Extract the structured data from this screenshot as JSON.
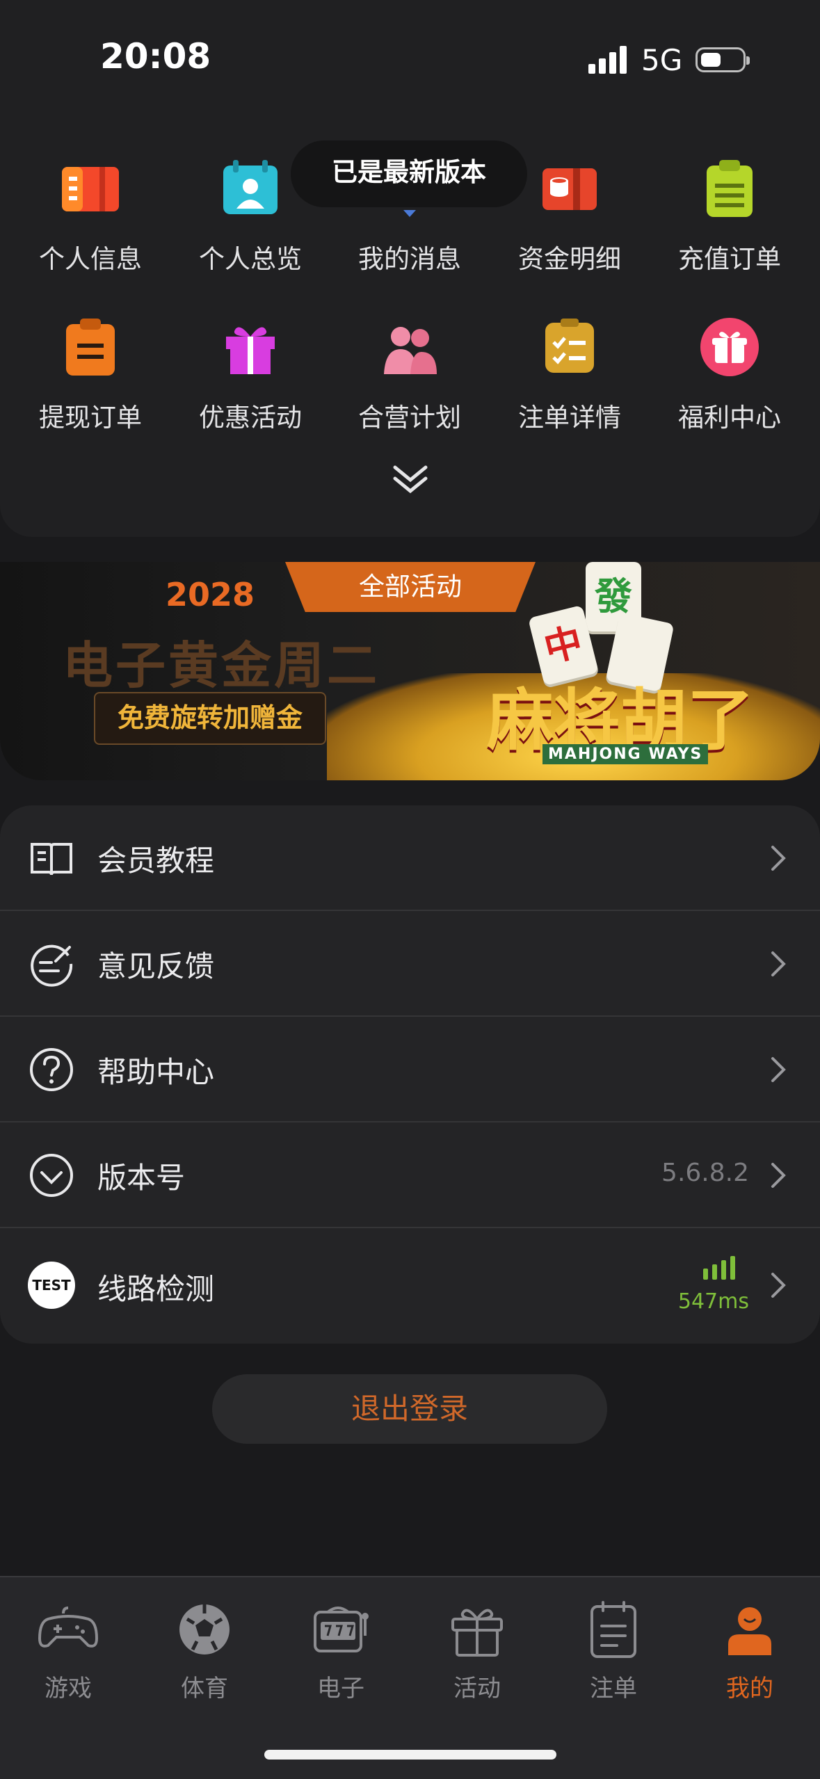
{
  "status": {
    "time": "20:08",
    "network": "5G"
  },
  "toast": "已是最新版本",
  "grid": [
    {
      "label": "个人信息",
      "icon": "profile-card-icon",
      "color": "#f4482a"
    },
    {
      "label": "个人总览",
      "icon": "calendar-user-icon",
      "color": "#2dbfd6"
    },
    {
      "label": "我的消息",
      "icon": "message-icon",
      "color": "#4a7ad8"
    },
    {
      "label": "资金明细",
      "icon": "funds-icon",
      "color": "#e6452b"
    },
    {
      "label": "充值订单",
      "icon": "clipboard-icon",
      "color": "#b5d62a"
    },
    {
      "label": "提现订单",
      "icon": "withdraw-icon",
      "color": "#f07a1e"
    },
    {
      "label": "优惠活动",
      "icon": "gift-icon",
      "color": "#d83de0"
    },
    {
      "label": "合营计划",
      "icon": "partners-icon",
      "color": "#f08da8"
    },
    {
      "label": "注单详情",
      "icon": "checklist-icon",
      "color": "#d9a42c"
    },
    {
      "label": "福利中心",
      "icon": "welfare-gift-icon",
      "color": "#f2456e"
    }
  ],
  "banner": {
    "tag": "全部活动",
    "year": "2028",
    "title": "电子黄金周二",
    "button": "免费旋转加赠金",
    "logo": "麻将胡了",
    "logo_sub": "MAHJONG WAYS"
  },
  "menu": {
    "tutorial": "会员教程",
    "feedback": "意见反馈",
    "help": "帮助中心",
    "version_label": "版本号",
    "version_value": "5.6.8.2",
    "line_test": "线路检测",
    "line_test_badge": "TEST",
    "latency": "547ms"
  },
  "logout": "退出登录",
  "tabs": [
    {
      "label": "游戏",
      "icon": "gamepad-icon",
      "active": false
    },
    {
      "label": "体育",
      "icon": "soccer-ball-icon",
      "active": false
    },
    {
      "label": "电子",
      "icon": "slot-machine-icon",
      "active": false
    },
    {
      "label": "活动",
      "icon": "gift-box-icon",
      "active": false
    },
    {
      "label": "注单",
      "icon": "clipboard-list-icon",
      "active": false
    },
    {
      "label": "我的",
      "icon": "user-icon",
      "active": true
    }
  ],
  "colors": {
    "accent": "#e0661f",
    "latency_good": "#7fbf3a"
  }
}
